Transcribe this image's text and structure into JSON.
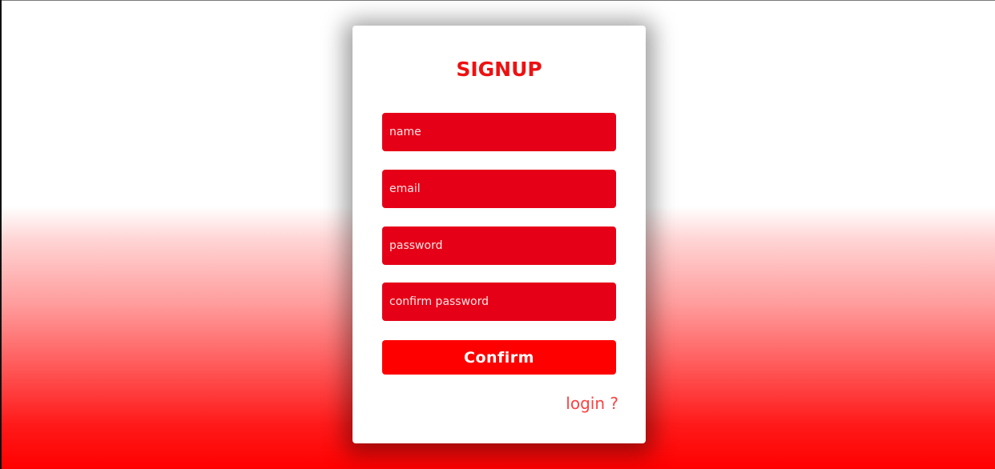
{
  "signup": {
    "title": "SIGNUP",
    "fields": [
      {
        "placeholder": "name"
      },
      {
        "placeholder": "email"
      },
      {
        "placeholder": "password"
      },
      {
        "placeholder": "confirm password"
      }
    ],
    "confirm_label": "Confirm",
    "login_link": "login ?"
  },
  "colors": {
    "accent": "#ff0000",
    "field_background": "#e60017",
    "title": "#ee1111",
    "link": "#ff4040"
  }
}
